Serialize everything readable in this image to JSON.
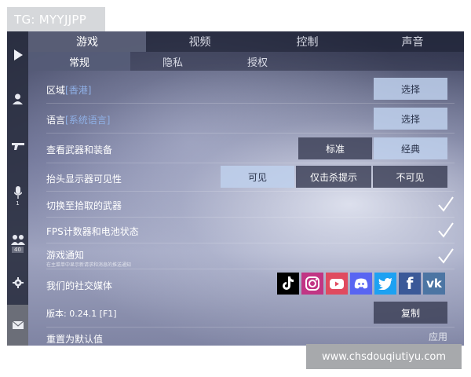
{
  "watermarks": {
    "top": "TG: MYYJJPP",
    "bottom": "www.chsdouqiutiyu.com"
  },
  "sidebar": {
    "items": [
      {
        "icon": "play-icon"
      },
      {
        "icon": "user-icon"
      },
      {
        "icon": "gun-icon"
      },
      {
        "icon": "microphone-icon",
        "count": "1"
      },
      {
        "icon": "group-icon",
        "count": "40"
      },
      {
        "icon": "gear-icon"
      },
      {
        "icon": "mail-icon"
      }
    ]
  },
  "tabs": {
    "main": [
      "游戏",
      "视频",
      "控制",
      "声音"
    ],
    "main_active": "游戏",
    "sub": [
      "常规",
      "隐私",
      "授权"
    ],
    "sub_active": "常规"
  },
  "settings": {
    "region": {
      "label": "区域",
      "hint": "[香港]",
      "button": "选择"
    },
    "language": {
      "label": "语言",
      "hint": "[系统语言]",
      "button": "选择"
    },
    "weapons": {
      "label": "查看武器和装备",
      "options": [
        "标准",
        "经典"
      ],
      "selected": "经典"
    },
    "hud": {
      "label": "抬头显示器可见性",
      "options": [
        "可见",
        "仅击杀提示",
        "不可见"
      ],
      "selected": "可见"
    },
    "switch_weapon": {
      "label": "切换至拾取的武器",
      "checked": true
    },
    "fps": {
      "label": "FPS计数器和电池状态",
      "checked": true
    },
    "notifications": {
      "label": "游戏通知",
      "sublabel": "在主菜单中显示新请求和消息的推送通知",
      "checked": true
    },
    "social": {
      "label": "我们的社交媒体",
      "icons": [
        "tiktok-icon",
        "instagram-icon",
        "youtube-icon",
        "discord-icon",
        "twitter-icon",
        "facebook-icon",
        "vk-icon"
      ]
    },
    "version": {
      "label": "版本: 0.24.1 [F1]",
      "button": "复制"
    },
    "reset": {
      "label": "重置为默认值",
      "button": "应用"
    }
  },
  "colors": {
    "accent_light": "#bed0ec",
    "tiktok": "#000000",
    "instagram": "#c13584",
    "youtube": "#e04a5f",
    "discord": "#5865f2",
    "twitter": "#1da1f2",
    "facebook": "#3b5998",
    "vk": "#4c75a3"
  }
}
